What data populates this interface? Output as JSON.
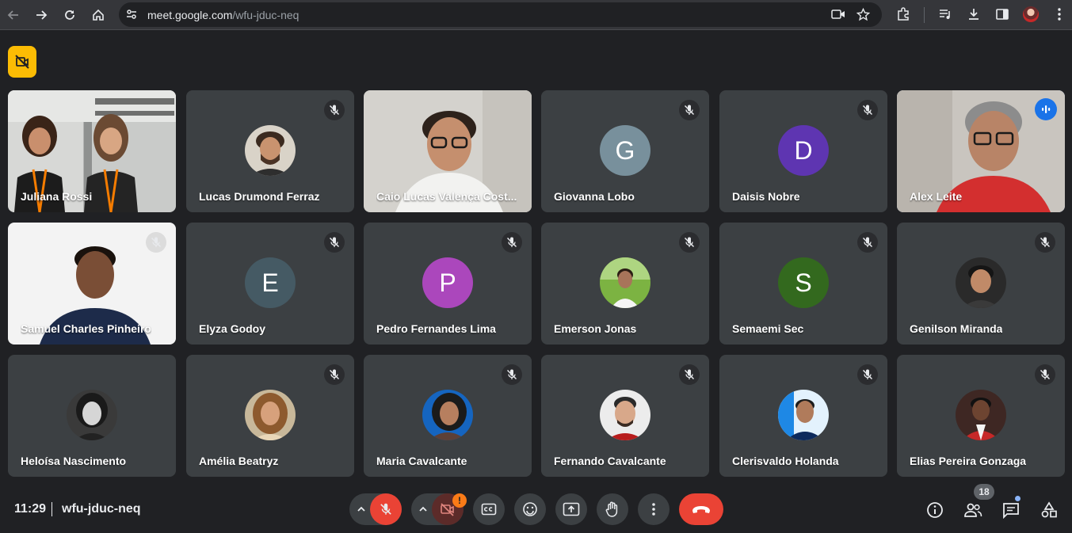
{
  "browser": {
    "url_host": "meet.google.com",
    "url_path": "/wfu-jduc-neq"
  },
  "tiles": [
    {
      "name": "Juliana Rossi",
      "kind": "video"
    },
    {
      "name": "Lucas Drumond Ferraz",
      "kind": "photo",
      "muted": true
    },
    {
      "name": "Caio Lucas Valença Cost...",
      "kind": "video"
    },
    {
      "name": "Giovanna Lobo",
      "kind": "letter",
      "letter": "G",
      "color": "#78909c",
      "muted": true
    },
    {
      "name": "Daisis Nobre",
      "kind": "letter",
      "letter": "D",
      "color": "#5e35b1",
      "muted": true
    },
    {
      "name": "Alex Leite",
      "kind": "video",
      "speaking": true
    },
    {
      "name": "Samuel Charles Pinheiro",
      "kind": "video",
      "muted": true
    },
    {
      "name": "Elyza Godoy",
      "kind": "letter",
      "letter": "E",
      "color": "#455a64",
      "muted": true
    },
    {
      "name": "Pedro Fernandes Lima",
      "kind": "letter",
      "letter": "P",
      "color": "#ab47bc",
      "muted": true
    },
    {
      "name": "Emerson Jonas",
      "kind": "photo",
      "muted": true
    },
    {
      "name": "Semaemi Sec",
      "kind": "letter",
      "letter": "S",
      "color": "#33691e",
      "muted": true
    },
    {
      "name": "Genilson Miranda",
      "kind": "photo",
      "muted": true
    },
    {
      "name": "Heloísa Nascimento",
      "kind": "photo"
    },
    {
      "name": "Amélia Beatryz",
      "kind": "photo",
      "muted": true
    },
    {
      "name": "Maria Cavalcante",
      "kind": "photo",
      "muted": true
    },
    {
      "name": "Fernando Cavalcante",
      "kind": "photo",
      "muted": true
    },
    {
      "name": "Clerisvaldo Holanda",
      "kind": "photo",
      "muted": true
    },
    {
      "name": "Elias Pereira Gonzaga",
      "kind": "photo",
      "muted": true
    }
  ],
  "bottom_bar": {
    "time": "11:29",
    "meeting_code": "wfu-jduc-neq",
    "camera_warning": "!",
    "participants_count": "18"
  },
  "colors": {
    "background": "#202124",
    "tile": "#3c4043",
    "red": "#ea4335",
    "accent_blue": "#8ab4f8",
    "yellow": "#fbbc04"
  }
}
